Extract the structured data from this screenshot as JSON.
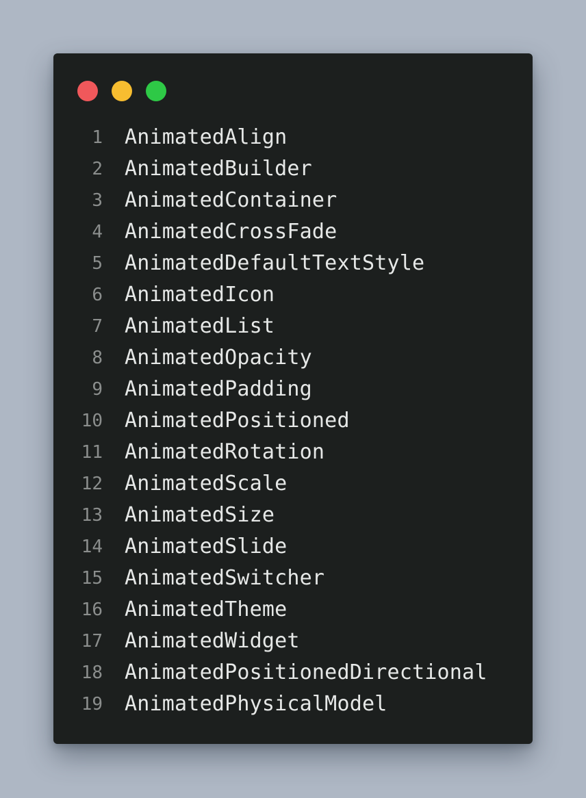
{
  "window": {
    "controls": [
      {
        "name": "close",
        "color": "#f0585b"
      },
      {
        "name": "minimize",
        "color": "#f7bd30"
      },
      {
        "name": "maximize",
        "color": "#2ec946"
      }
    ]
  },
  "code": {
    "lines": [
      {
        "num": "1",
        "text": "AnimatedAlign"
      },
      {
        "num": "2",
        "text": "AnimatedBuilder"
      },
      {
        "num": "3",
        "text": "AnimatedContainer"
      },
      {
        "num": "4",
        "text": "AnimatedCrossFade"
      },
      {
        "num": "5",
        "text": "AnimatedDefaultTextStyle"
      },
      {
        "num": "6",
        "text": "AnimatedIcon"
      },
      {
        "num": "7",
        "text": "AnimatedList"
      },
      {
        "num": "8",
        "text": "AnimatedOpacity"
      },
      {
        "num": "9",
        "text": "AnimatedPadding"
      },
      {
        "num": "10",
        "text": "AnimatedPositioned"
      },
      {
        "num": "11",
        "text": "AnimatedRotation"
      },
      {
        "num": "12",
        "text": "AnimatedScale"
      },
      {
        "num": "13",
        "text": "AnimatedSize"
      },
      {
        "num": "14",
        "text": "AnimatedSlide"
      },
      {
        "num": "15",
        "text": "AnimatedSwitcher"
      },
      {
        "num": "16",
        "text": "AnimatedTheme"
      },
      {
        "num": "17",
        "text": "AnimatedWidget"
      },
      {
        "num": "18",
        "text": "AnimatedPositionedDirectional"
      },
      {
        "num": "19",
        "text": "AnimatedPhysicalModel"
      }
    ]
  }
}
